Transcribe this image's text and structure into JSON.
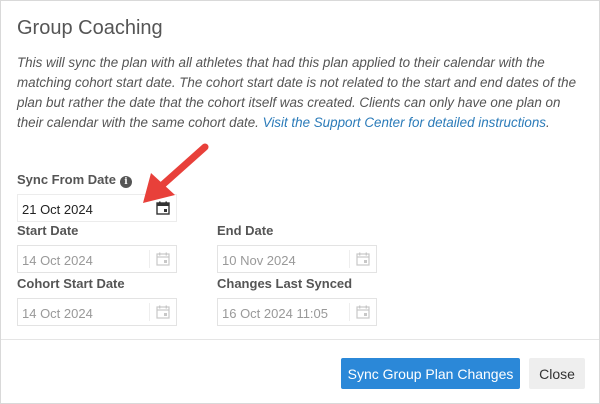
{
  "dialog": {
    "title": "Group Coaching",
    "description": "This will sync the plan with all athletes that had this plan applied to their calendar with the matching cohort start date. The cohort start date is not related to the start and end dates of the plan but rather the date that the cohort itself was created. Clients can only have one plan on their calendar with the same cohort date. ",
    "support_link": "Visit the Support Center for detailed instructions",
    "description_end": "."
  },
  "fields": {
    "sync_from": {
      "label": "Sync From Date",
      "value": "21 Oct 2024"
    },
    "start_date": {
      "label": "Start Date",
      "value": "14 Oct 2024"
    },
    "end_date": {
      "label": "End Date",
      "value": "10 Nov 2024"
    },
    "cohort_start": {
      "label": "Cohort Start Date",
      "value": "14 Oct 2024"
    },
    "last_synced": {
      "label": "Changes Last Synced",
      "value": "16 Oct 2024 11:05"
    }
  },
  "buttons": {
    "sync": "Sync Group Plan Changes",
    "close": "Close"
  },
  "icons": {
    "info": "info-icon",
    "calendar": "calendar-icon",
    "annotation_arrow": "red-arrow"
  },
  "colors": {
    "primary": "#2b88d8",
    "link": "#2b7bb9",
    "arrow": "#e8403a"
  }
}
